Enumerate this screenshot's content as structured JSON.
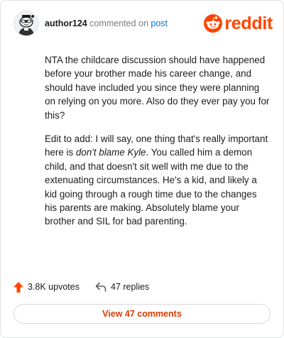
{
  "header": {
    "author": "author124",
    "action_text": "commented on",
    "post_link": "post",
    "logo_text": "reddit",
    "avatar_icon": "snoo-avatar-icon",
    "logo_icon": "reddit-alien-icon"
  },
  "comment": {
    "paragraph1": "NTA the childcare discussion should have happened before your brother made his career change, and should have included you since they were planning on relying on you more. Also do they ever pay you for this?",
    "paragraph2_before": "Edit to add: I will say, one thing that's really important here is ",
    "paragraph2_emphasis": "don't blame Kyle",
    "paragraph2_after": ". You called him a demon child, and that doesn't sit well with me due to the extenuating circumstances. He's a kid, and likely a kid going through a rough time due to the changes his parents are making. Absolutely blame your brother and SIL for bad parenting."
  },
  "footer": {
    "upvotes": "3.8K upvotes",
    "replies": "47 replies",
    "view_button": "View 47 comments",
    "upvote_icon": "upvote-arrow-icon",
    "reply_icon": "reply-arrow-icon"
  },
  "colors": {
    "brand": "#ff4500",
    "link": "#0079d3",
    "button_text": "#d93a00"
  }
}
